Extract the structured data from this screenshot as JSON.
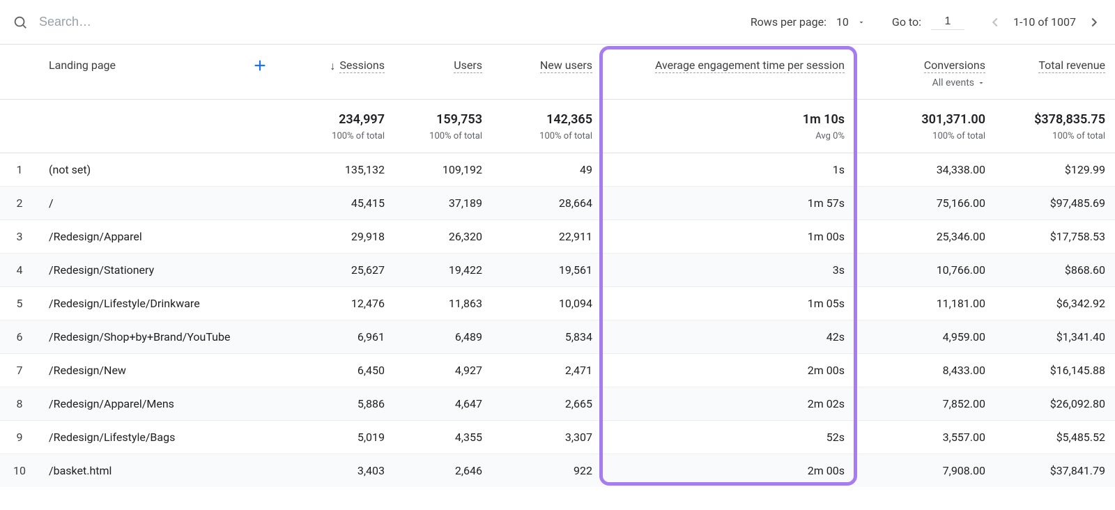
{
  "toolbar": {
    "search_placeholder": "Search…",
    "rows_per_page_label": "Rows per page:",
    "rows_per_page_value": "10",
    "goto_label": "Go to:",
    "goto_value": "1",
    "range_text": "1-10 of 1007"
  },
  "table": {
    "dimension_header": "Landing page",
    "columns": [
      {
        "label": "Sessions",
        "sorted_desc": true
      },
      {
        "label": "Users"
      },
      {
        "label": "New users"
      },
      {
        "label": "Average engagement time per session"
      },
      {
        "label": "Conversions",
        "sublabel": "All events"
      },
      {
        "label": "Total revenue"
      }
    ],
    "summary": {
      "sessions": "234,997",
      "sessions_pct": "100% of total",
      "users": "159,753",
      "users_pct": "100% of total",
      "new_users": "142,365",
      "new_users_pct": "100% of total",
      "avg_time": "1m 10s",
      "avg_time_pct": "Avg 0%",
      "conversions": "301,371.00",
      "conversions_pct": "100% of total",
      "revenue": "$378,835.75",
      "revenue_pct": "100% of total"
    },
    "rows": [
      {
        "idx": "1",
        "page": "(not set)",
        "sessions": "135,132",
        "users": "109,192",
        "new_users": "49",
        "avg_time": "1s",
        "conversions": "34,338.00",
        "revenue": "$129.99"
      },
      {
        "idx": "2",
        "page": "/",
        "sessions": "45,415",
        "users": "37,189",
        "new_users": "28,664",
        "avg_time": "1m 57s",
        "conversions": "75,166.00",
        "revenue": "$97,485.69"
      },
      {
        "idx": "3",
        "page": "/Redesign/Apparel",
        "sessions": "29,918",
        "users": "26,320",
        "new_users": "22,911",
        "avg_time": "1m 00s",
        "conversions": "25,346.00",
        "revenue": "$17,758.53"
      },
      {
        "idx": "4",
        "page": "/Redesign/Stationery",
        "sessions": "25,627",
        "users": "19,422",
        "new_users": "19,561",
        "avg_time": "3s",
        "conversions": "10,766.00",
        "revenue": "$868.60"
      },
      {
        "idx": "5",
        "page": "/Redesign/Lifestyle/Drinkware",
        "sessions": "12,476",
        "users": "11,863",
        "new_users": "10,094",
        "avg_time": "1m 05s",
        "conversions": "11,181.00",
        "revenue": "$6,342.92"
      },
      {
        "idx": "6",
        "page": "/Redesign/Shop+by+Brand/YouTube",
        "sessions": "6,961",
        "users": "6,489",
        "new_users": "5,834",
        "avg_time": "42s",
        "conversions": "4,959.00",
        "revenue": "$1,341.40"
      },
      {
        "idx": "7",
        "page": "/Redesign/New",
        "sessions": "6,450",
        "users": "4,927",
        "new_users": "2,471",
        "avg_time": "2m 00s",
        "conversions": "8,433.00",
        "revenue": "$16,145.88"
      },
      {
        "idx": "8",
        "page": "/Redesign/Apparel/Mens",
        "sessions": "5,886",
        "users": "4,647",
        "new_users": "2,665",
        "avg_time": "2m 02s",
        "conversions": "7,852.00",
        "revenue": "$26,092.80"
      },
      {
        "idx": "9",
        "page": "/Redesign/Lifestyle/Bags",
        "sessions": "5,019",
        "users": "4,355",
        "new_users": "3,307",
        "avg_time": "52s",
        "conversions": "3,557.00",
        "revenue": "$5,485.52"
      },
      {
        "idx": "10",
        "page": "/basket.html",
        "sessions": "3,403",
        "users": "2,646",
        "new_users": "922",
        "avg_time": "2m 00s",
        "conversions": "7,908.00",
        "revenue": "$37,841.79"
      }
    ]
  },
  "highlight_column_index": 3
}
